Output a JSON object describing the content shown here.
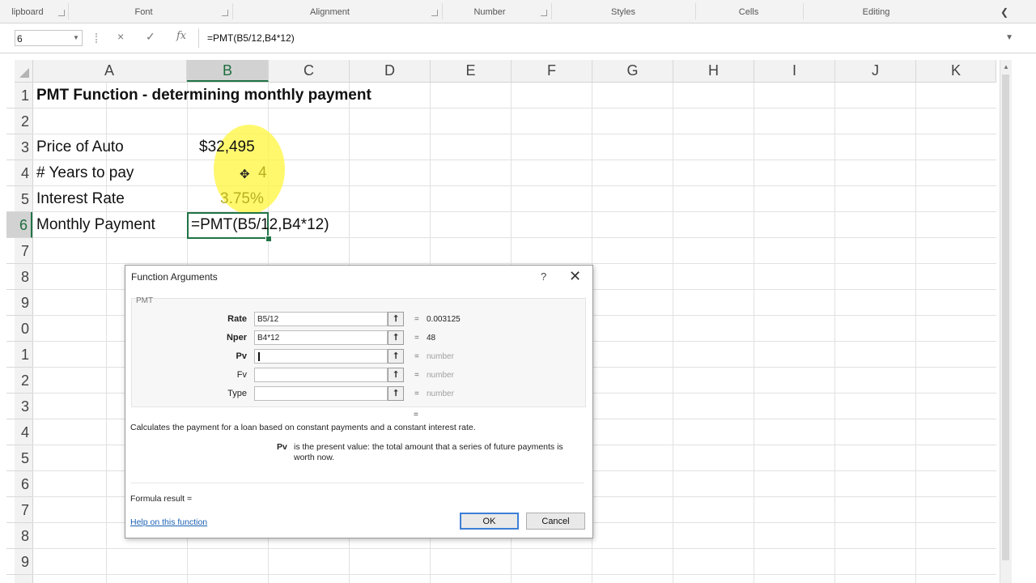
{
  "ribbon": {
    "groups": [
      "lipboard",
      "Font",
      "Alignment",
      "Number",
      "Styles",
      "Cells",
      "Editing"
    ]
  },
  "formula_bar": {
    "name_box": "6",
    "cancel_icon": "×",
    "enter_icon": "✓",
    "fx_label": "fx",
    "formula": "=PMT(B5/12,B4*12)"
  },
  "grid": {
    "columns": [
      "A",
      "B",
      "C",
      "D",
      "E",
      "F",
      "G",
      "H",
      "I",
      "J",
      "K"
    ],
    "selected_column": "B",
    "rows": [
      "1",
      "2",
      "3",
      "4",
      "5",
      "6",
      "7",
      "8",
      "9",
      "0",
      "1",
      "2",
      "3",
      "4",
      "5",
      "6",
      "7",
      "8",
      "9"
    ],
    "selected_row_index": 5,
    "cells": {
      "a1": "PMT Function - determining monthly payment",
      "a3": "Price of Auto",
      "b3": "$32,495",
      "a4": "# Years to pay",
      "b4": "4",
      "a5": "Interest Rate",
      "b5": "3.75%",
      "a6": "Monthly Payment",
      "b6": "=PMT(B5/12,B4*12)"
    }
  },
  "dialog": {
    "title": "Function Arguments",
    "help_icon": "?",
    "close_icon": "✕",
    "function_name": "PMT",
    "args": [
      {
        "label": "Rate",
        "value": "B5/12",
        "result": "0.003125",
        "required": true
      },
      {
        "label": "Nper",
        "value": "B4*12",
        "result": "48",
        "required": true
      },
      {
        "label": "Pv",
        "value": "",
        "result": "number",
        "required": true
      },
      {
        "label": "Fv",
        "value": "",
        "result": "number",
        "required": false
      },
      {
        "label": "Type",
        "value": "",
        "result": "number",
        "required": false
      }
    ],
    "equals": "=",
    "result_equals": "=",
    "description": "Calculates the payment for a loan based on constant payments and a constant interest rate.",
    "arg_help_name": "Pv",
    "arg_help_text": "is the present value: the total amount that a series of future payments is worth now.",
    "formula_result": "Formula result =",
    "help_link": "Help on this function",
    "ok_label": "OK",
    "cancel_label": "Cancel"
  }
}
